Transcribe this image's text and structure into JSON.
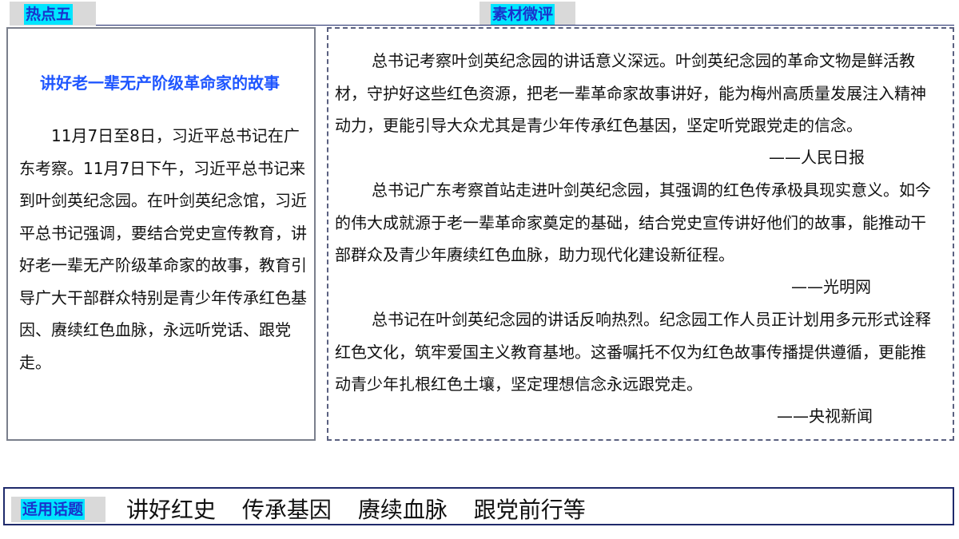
{
  "header": {
    "left_tag": "热点五",
    "right_tag": "素材微评"
  },
  "hotspot": {
    "title": "讲好老一辈无产阶级革命家的故事",
    "body": "11月7日至8日，习近平总书记在广东考察。11月7日下午，习近平总书记来到叶剑英纪念园。在叶剑英纪念馆，习近平总书记强调，要结合党史宣传教育，讲好老一辈无产阶级革命家的故事，教育引导广大干部群众特别是青少年传承红色基因、赓续红色血脉，永远听党话、跟党走。"
  },
  "comments": [
    {
      "text": "总书记考察叶剑英纪念园的讲话意义深远。叶剑英纪念园的革命文物是鲜活教材，守护好这些红色资源，把老一辈革命家故事讲好，能为梅州高质量发展注入精神动力，更能引导大众尤其是青少年传承红色基因，坚定听党跟党走的信念。",
      "source": "——人民日报"
    },
    {
      "text": "总书记广东考察首站走进叶剑英纪念园，其强调的红色传承极具现实意义。如今的伟大成就源于老一辈革命家奠定的基础，结合党史宣传讲好他们的故事，能推动干部群众及青少年赓续红色血脉，助力现代化建设新征程。",
      "source": "——光明网"
    },
    {
      "text": "总书记在叶剑英纪念园的讲话反响热烈。纪念园工作人员正计划用多元形式诠释红色文化，筑牢爱国主义教育基地。这番嘱托不仅为红色故事传播提供遵循，更能推动青少年扎根红色土壤，坚定理想信念永远跟党走。",
      "source": "——央视新闻"
    }
  ],
  "topics": {
    "tag": "适用话题",
    "items": [
      "讲好红史",
      "传承基因",
      "赓续血脉",
      "跟党前行等"
    ]
  },
  "colors": {
    "tag_highlight": "#00e5ff",
    "tag_text": "#1a33cc",
    "title_blue": "#1f56ff",
    "frame_navy": "#1f2a6b"
  }
}
